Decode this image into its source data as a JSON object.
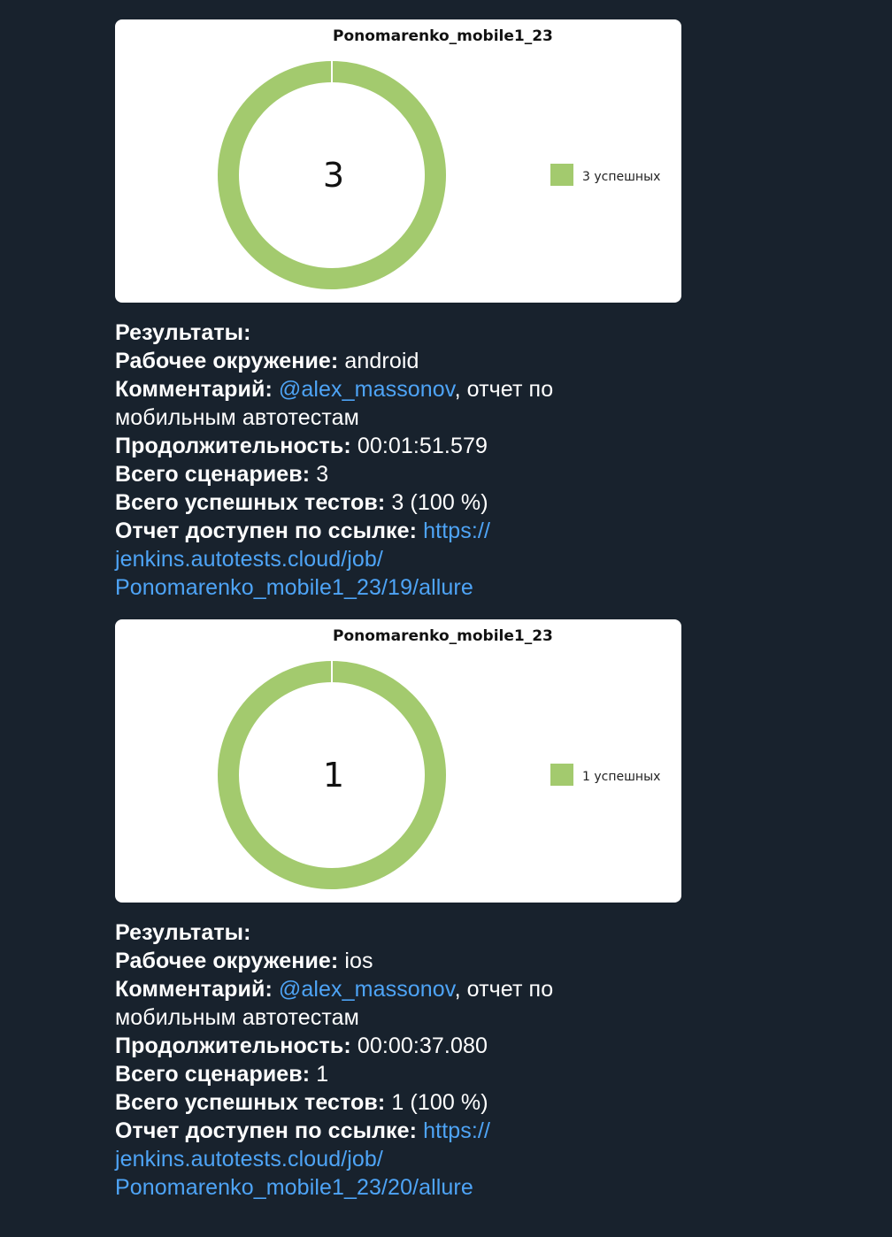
{
  "messages": [
    {
      "chart_data": {
        "type": "pie",
        "title": "Ponomarenko_mobile1_23",
        "center_label": "3",
        "slices": [
          {
            "label": "3 успешных",
            "value": 3,
            "color": "#a3ca6e"
          }
        ]
      },
      "results": {
        "title": "Результаты:",
        "env_label": "Рабочее окружение:",
        "env_value": "android",
        "comment_label": "Комментарий:",
        "comment_mention": "@alex_massonov",
        "comment_rest": ", отчет по",
        "comment_rest2": "мобильным автотестам",
        "duration_label": "Продолжительность:",
        "duration_value": "00:01:51.579",
        "scenarios_label": "Всего сценариев:",
        "scenarios_value": "3",
        "passed_label": "Всего успешных тестов:",
        "passed_value": "3 (100 %)",
        "report_label": "Отчет доступен по ссылке:",
        "report_link_1": "https://",
        "report_link_2": "jenkins.autotests.cloud/job/",
        "report_link_3": "Ponomarenko_mobile1_23/19/allure"
      }
    },
    {
      "chart_data": {
        "type": "pie",
        "title": "Ponomarenko_mobile1_23",
        "center_label": "1",
        "slices": [
          {
            "label": "1 успешных",
            "value": 1,
            "color": "#a3ca6e"
          }
        ]
      },
      "results": {
        "title": "Результаты:",
        "env_label": "Рабочее окружение:",
        "env_value": "ios",
        "comment_label": "Комментарий:",
        "comment_mention": "@alex_massonov",
        "comment_rest": ", отчет по",
        "comment_rest2": "мобильным автотестам",
        "duration_label": "Продолжительность:",
        "duration_value": "00:00:37.080",
        "scenarios_label": "Всего сценариев:",
        "scenarios_value": "1",
        "passed_label": "Всего успешных тестов:",
        "passed_value": "1 (100 %)",
        "report_label": "Отчет доступен по ссылке:",
        "report_link_1": "https://",
        "report_link_2": "jenkins.autotests.cloud/job/",
        "report_link_3": "Ponomarenko_mobile1_23/20/allure"
      }
    }
  ]
}
